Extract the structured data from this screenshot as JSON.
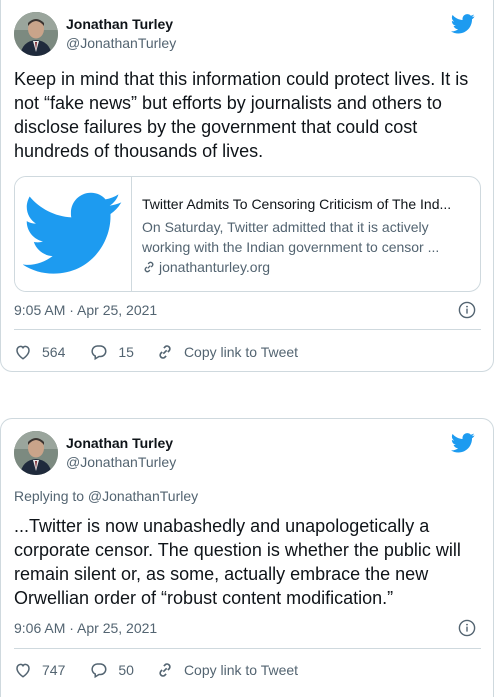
{
  "tweets": [
    {
      "author": {
        "display_name": "Jonathan Turley",
        "handle": "@JonathanTurley"
      },
      "text": "Keep in mind that this information could protect lives. It is not “fake news” but efforts by journalists and others to disclose failures by the government that could cost hundreds of thousands of lives.",
      "link_card": {
        "title": "Twitter Admits To Censoring Criticism of The Ind...",
        "description": "On Saturday, Twitter admitted that it is actively working with the Indian government to censor ...",
        "domain": "jonathanturley.org"
      },
      "timestamp": "9:05 AM · Apr 25, 2021",
      "likes": "564",
      "replies": "15",
      "copy_link_label": "Copy link to Tweet"
    },
    {
      "author": {
        "display_name": "Jonathan Turley",
        "handle": "@JonathanTurley"
      },
      "reply_to": "Replying to @JonathanTurley",
      "text": "...Twitter is now unabashedly and unapologetically a corporate censor. The question is whether the public will remain silent or, as some, actually embrace the new Orwellian order of “robust content modification.”",
      "timestamp": "9:06 AM · Apr 25, 2021",
      "likes": "747",
      "replies": "50",
      "copy_link_label": "Copy link to Tweet"
    }
  ],
  "colors": {
    "twitter_blue": "#1d9bf0",
    "text_primary": "#0f1419",
    "text_secondary": "#536471",
    "border": "#cfd9de"
  },
  "icons": [
    "twitter-bird-icon",
    "heart-icon",
    "reply-bubble-icon",
    "link-chain-icon",
    "info-icon"
  ]
}
